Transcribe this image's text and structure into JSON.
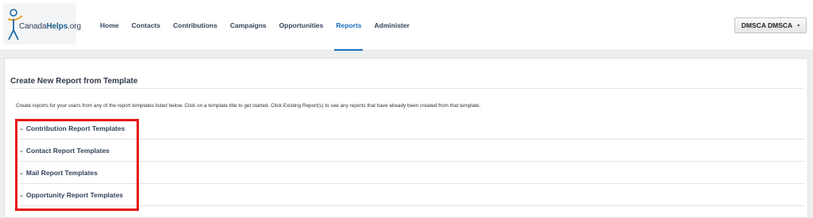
{
  "brand": {
    "logo_prefix": "Canada",
    "logo_bold": "Helps",
    "logo_suffix": ".org"
  },
  "nav": {
    "items": [
      {
        "label": "Home",
        "active": false
      },
      {
        "label": "Contacts",
        "active": false
      },
      {
        "label": "Contributions",
        "active": false
      },
      {
        "label": "Campaigns",
        "active": false
      },
      {
        "label": "Opportunities",
        "active": false
      },
      {
        "label": "Reports",
        "active": true
      },
      {
        "label": "Administer",
        "active": false
      }
    ]
  },
  "user_menu": {
    "label": "DMSCA DMSCA",
    "caret": "▾"
  },
  "card": {
    "title": "Create New Report from Template",
    "description": "Create reports for your users from any of the report templates listed below. Click on a template title to get started. Click Existing Report(s) to see any reports that have already been created from that template."
  },
  "templates": [
    {
      "label": "Contribution Report Templates",
      "chevron": "⌄"
    },
    {
      "label": "Contact Report Templates",
      "chevron": "⌄"
    },
    {
      "label": "Mail Report Templates",
      "chevron": "⌄"
    },
    {
      "label": "Opportunity Report Templates",
      "chevron": "⌄"
    }
  ],
  "colors": {
    "accent": "#1d6fbf",
    "highlight": "#e8141a",
    "nav_text": "#33435b"
  }
}
